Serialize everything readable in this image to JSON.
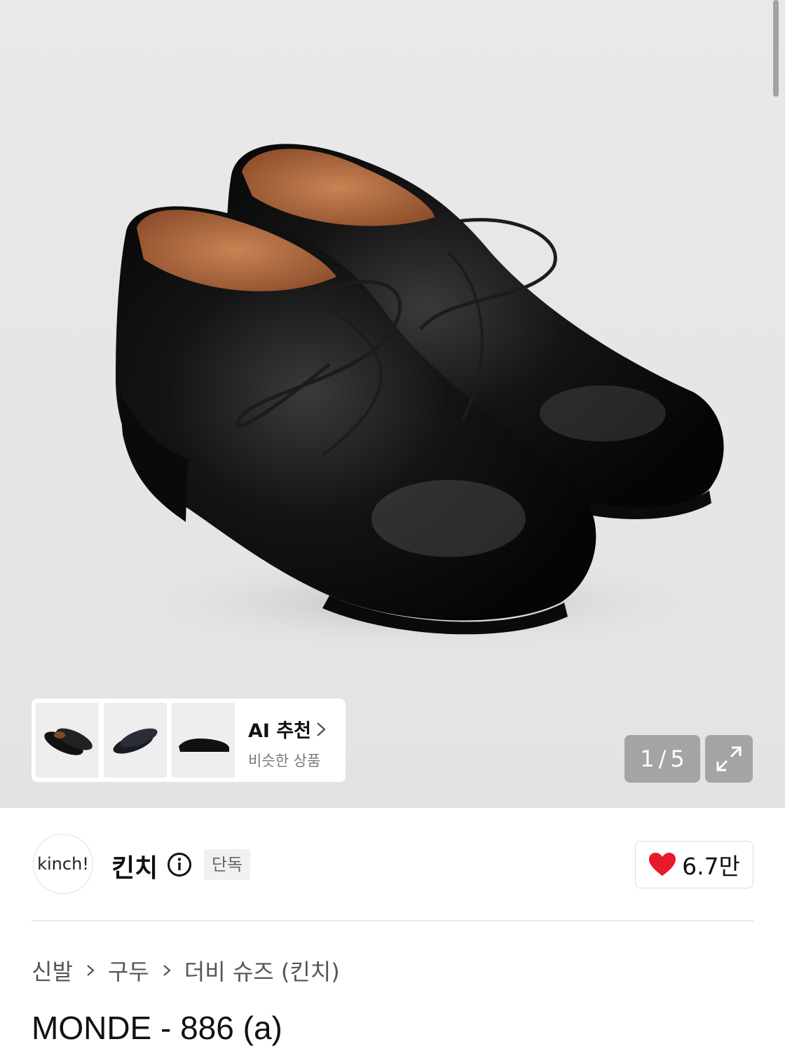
{
  "gallery": {
    "counter_current": "1",
    "counter_sep": "/",
    "counter_total": "5",
    "thumbnails": [
      "shoe-pair-top-view",
      "shoe-pair-side-view",
      "single-shoe-side-view"
    ],
    "ai": {
      "title": "AI 추천",
      "subtitle": "비슷한 상품"
    }
  },
  "brand": {
    "logo_text": "kinch!",
    "name": "킨치",
    "badge": "단독"
  },
  "like": {
    "count": "6.7만",
    "color": "#e8192c"
  },
  "breadcrumb": [
    "신발",
    "구두",
    "더비 슈즈 (킨치)"
  ],
  "product": {
    "title": "MONDE - 886 (a)"
  },
  "icons": {
    "info": "info-circle-icon",
    "expand": "expand-arrows-icon",
    "heart": "heart-icon",
    "chevron": "chevron-right-icon"
  }
}
